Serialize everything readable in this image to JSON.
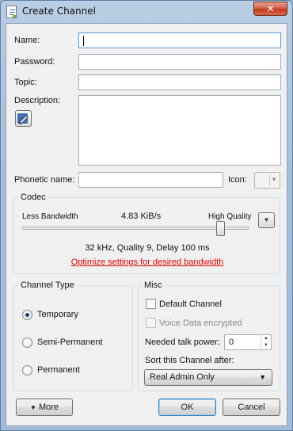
{
  "window": {
    "title": "Create Channel",
    "close_glyph": "✕"
  },
  "fields": {
    "name_label": "Name:",
    "name_value": "",
    "password_label": "Password:",
    "password_value": "",
    "topic_label": "Topic:",
    "topic_value": "",
    "description_label": "Description:",
    "description_value": "",
    "phonetic_label": "Phonetic name:",
    "phonetic_value": "",
    "icon_label": "Icon:"
  },
  "codec": {
    "title": "Codec",
    "less_bandwidth": "Less Bandwidth",
    "bitrate": "4.83 KiB/s",
    "high_quality": "High Quality",
    "slider_level": 0.85,
    "summary": "32 kHz, Quality 9, Delay 100 ms",
    "optimize_link": "Optimize settings for desired bandwidth"
  },
  "channel_type": {
    "title": "Channel Type",
    "options": [
      "Temporary",
      "Semi-Permanent",
      "Permanent"
    ],
    "selected": "Temporary"
  },
  "misc": {
    "title": "Misc",
    "default_channel": "Default Channel",
    "default_channel_checked": false,
    "voice_encrypted": "Voice Data encrypted",
    "voice_encrypted_enabled": false,
    "talk_power_label": "Needed talk power:",
    "talk_power_value": "0",
    "sort_label": "Sort this Channel after:",
    "sort_value": "Real Admin Only"
  },
  "buttons": {
    "more": "More",
    "ok": "OK",
    "cancel": "Cancel"
  },
  "icons": {
    "window": "document-icon",
    "edit": "pen-icon",
    "quality": "chevron-down-icon",
    "dropdown": "triangle-down-icon"
  }
}
